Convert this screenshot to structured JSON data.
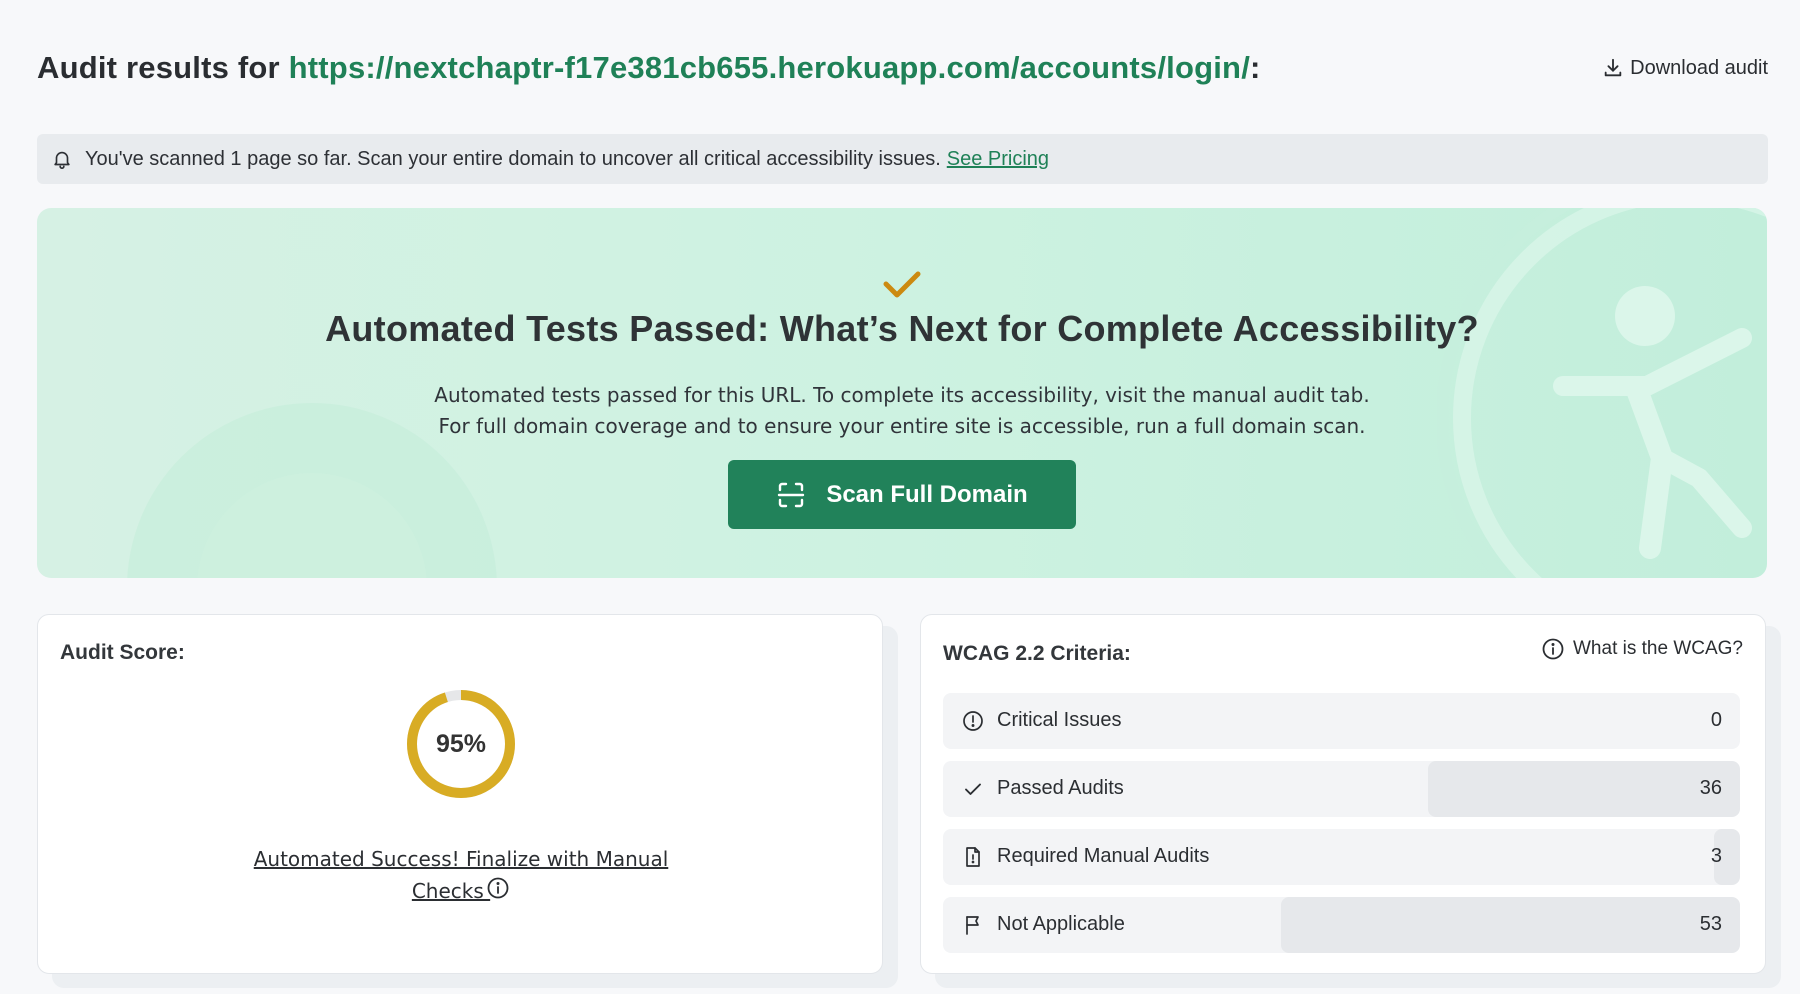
{
  "header": {
    "title_prefix": "Audit results for ",
    "url": "https://nextchaptr-f17e381cb655.herokuapp.com/accounts/login/",
    "title_suffix": ":",
    "download_label": "Download audit"
  },
  "notice": {
    "text": "You've scanned 1 page so far. Scan your entire domain to uncover all critical accessibility issues.",
    "link_label": "See Pricing"
  },
  "hero": {
    "title": "Automated Tests Passed: What’s Next for Complete Accessibility?",
    "line1": "Automated tests passed for this URL. To complete its accessibility, visit the manual audit tab.",
    "line2": "For full domain coverage and to ensure your entire site is accessible, run a full domain scan.",
    "button_label": "Scan Full Domain"
  },
  "score": {
    "title": "Audit Score:",
    "value": "95%",
    "percent": 95,
    "link_line1": "Automated Success! Finalize with Manual",
    "link_line2": "Checks "
  },
  "wcag": {
    "title": "WCAG 2.2 Criteria:",
    "help_label": "What is the WCAG?",
    "rows": [
      {
        "label": "Critical Issues",
        "count": "0",
        "icon": "alert-circle-icon"
      },
      {
        "label": "Passed Audits",
        "count": "36",
        "icon": "check-icon"
      },
      {
        "label": "Required Manual Audits",
        "count": "3",
        "icon": "document-icon"
      },
      {
        "label": "Not Applicable",
        "count": "53",
        "icon": "flag-icon"
      }
    ]
  },
  "colors": {
    "brand_green": "#1f8157",
    "button_green": "#21825a",
    "score_gold": "#d8ac24",
    "check_gold": "#cc8a10"
  }
}
